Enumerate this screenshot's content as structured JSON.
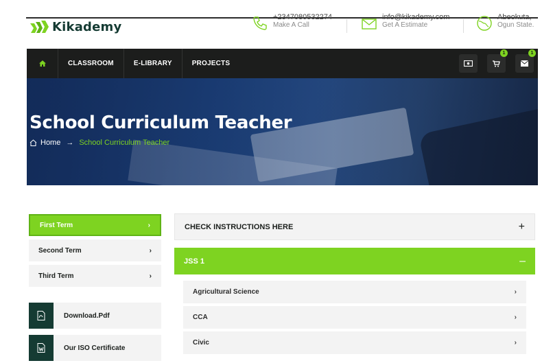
{
  "brand": {
    "name": "Kikademy"
  },
  "contacts": [
    {
      "main": "+2347080532274",
      "sub": "Make A Call",
      "icon": "phone-icon"
    },
    {
      "main": "info@kikademy.com",
      "sub": "Get A Estimate",
      "icon": "email-icon"
    },
    {
      "main": "Abeokuta,",
      "sub": "Ogun State.",
      "icon": "location-icon"
    }
  ],
  "nav": {
    "items": [
      {
        "label": "CLASSROOM"
      },
      {
        "label": "E-LIBRARY"
      },
      {
        "label": "PROJECTS"
      }
    ],
    "cart_count": "1",
    "mail_count": "1"
  },
  "hero": {
    "title": "School Curriculum Teacher",
    "breadcrumb_home": "Home",
    "breadcrumb_sep": "→",
    "breadcrumb_current": "School Curriculum Teacher"
  },
  "sidebar": {
    "terms": [
      {
        "label": "First Term",
        "arrow": "›"
      },
      {
        "label": "Second Term",
        "arrow": "›"
      },
      {
        "label": "Third Term",
        "arrow": "›"
      }
    ],
    "downloads": [
      {
        "label": "Download.Pdf",
        "icon": "pdf-file-icon"
      },
      {
        "label": "Our ISO Certificate",
        "icon": "word-file-icon"
      }
    ]
  },
  "accordion": {
    "instructions_label": "CHECK INSTRUCTIONS HERE",
    "instructions_sign": "+",
    "jss1_label": "JSS 1",
    "jss1_sign": "–",
    "subjects": [
      {
        "label": "Agricultural Science",
        "arrow": "›"
      },
      {
        "label": "CCA",
        "arrow": "›"
      },
      {
        "label": "Civic",
        "arrow": "›"
      }
    ]
  },
  "colors": {
    "accent": "#7ed321",
    "dark": "#1c1d1c",
    "brand_green": "#153b33"
  }
}
